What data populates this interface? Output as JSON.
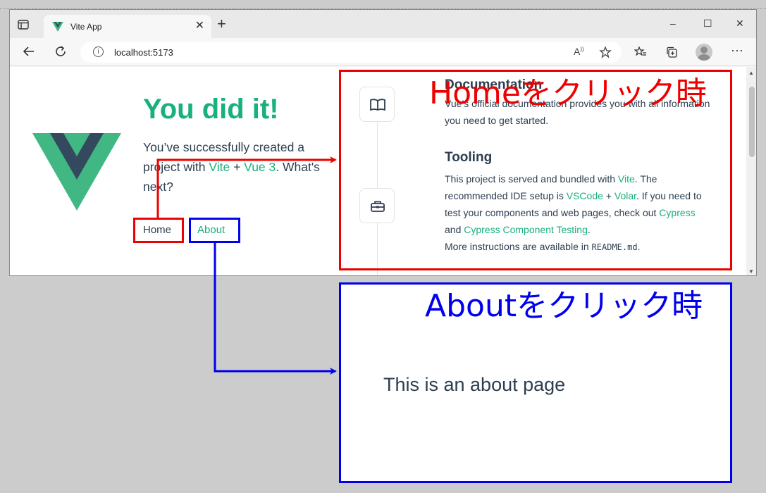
{
  "browser": {
    "tab_title": "Vite App",
    "url": "localhost:5173",
    "tab_close_glyph": "✕",
    "new_tab_glyph": "+",
    "window_controls": [
      "–",
      "☐",
      "✕"
    ]
  },
  "page": {
    "heading": "You did it!",
    "intro_prefix": "You’ve successfully created a project with ",
    "link_vite": "Vite",
    "plus": " + ",
    "link_vue": "Vue 3",
    "intro_suffix": ". What's next?",
    "nav": {
      "home": "Home",
      "about": "About"
    },
    "items": [
      {
        "title": "Documentation",
        "text": "Vue’s official documentation provides you with all information you need to get started.",
        "icon": "book-icon"
      },
      {
        "title": "Tooling",
        "line1_prefix": "This project is served and bundled with ",
        "line1_link": "Vite",
        "line1_suffix": ". The",
        "line2_prefix": "recommended IDE setup is ",
        "line2_link1": "VSCode",
        "line2_plus": " + ",
        "line2_link2": "Volar",
        "line2_suffix": ". If you need to",
        "line3_prefix": "test your components and web pages, check out ",
        "line3_link": "Cypress",
        "line4_prefix": "and ",
        "line4_link": "Cypress Component Testing",
        "line4_suffix": ".",
        "line5_prefix": "More instructions are available in ",
        "line5_code": "README.md",
        "line5_suffix": ".",
        "icon": "toolbox-icon"
      }
    ]
  },
  "annotations": {
    "home_label": "Homeをクリック時",
    "about_label": "Aboutをクリック時",
    "about_page_text": "This is an about page",
    "home_color": "#ee0000",
    "about_color": "#0000ee"
  },
  "colors": {
    "vue_green": "#18b07d",
    "vue_dark": "#35495e",
    "text": "#2c3e50"
  }
}
